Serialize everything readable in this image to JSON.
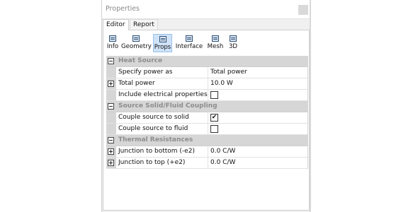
{
  "window": {
    "title": "Properties"
  },
  "tabs": [
    {
      "label": "Editor",
      "active": true
    },
    {
      "label": "Report",
      "active": false
    }
  ],
  "toolbar": [
    {
      "label": "Info",
      "icon": "grid-icon",
      "active": false
    },
    {
      "label": "Geometry",
      "icon": "grid-icon",
      "active": false
    },
    {
      "label": "Props",
      "icon": "grid-icon",
      "active": true
    },
    {
      "label": "Interface",
      "icon": "grid-icon",
      "active": false
    },
    {
      "label": "Mesh",
      "icon": "grid-icon",
      "active": false
    },
    {
      "label": "3D",
      "icon": "grid-icon",
      "active": false
    }
  ],
  "sections": {
    "heat_source": {
      "label": "Heat Source",
      "rows": [
        {
          "name": "Specify power as",
          "value": "Total power"
        },
        {
          "name": "Total power",
          "value": "10.0 W",
          "expandable": true
        },
        {
          "name": "Include electrical properties",
          "checked": false
        }
      ]
    },
    "coupling": {
      "label": "Source Solid/Fluid Coupling",
      "rows": [
        {
          "name": "Couple source to solid",
          "checked": true
        },
        {
          "name": "Couple source to fluid",
          "checked": false
        }
      ]
    },
    "thermal": {
      "label": "Thermal Resistances",
      "rows": [
        {
          "name": "Junction to bottom (-e2)",
          "value": "0.0 C/W",
          "expandable": true
        },
        {
          "name": "Junction to top (+e2)",
          "value": "0.0 C/W",
          "expandable": true
        }
      ]
    }
  },
  "check_mark": "✔",
  "colors": {
    "accent": "#cfe2f7",
    "section_bg": "#d6d6d6",
    "section_text": "#8d8d8d"
  }
}
